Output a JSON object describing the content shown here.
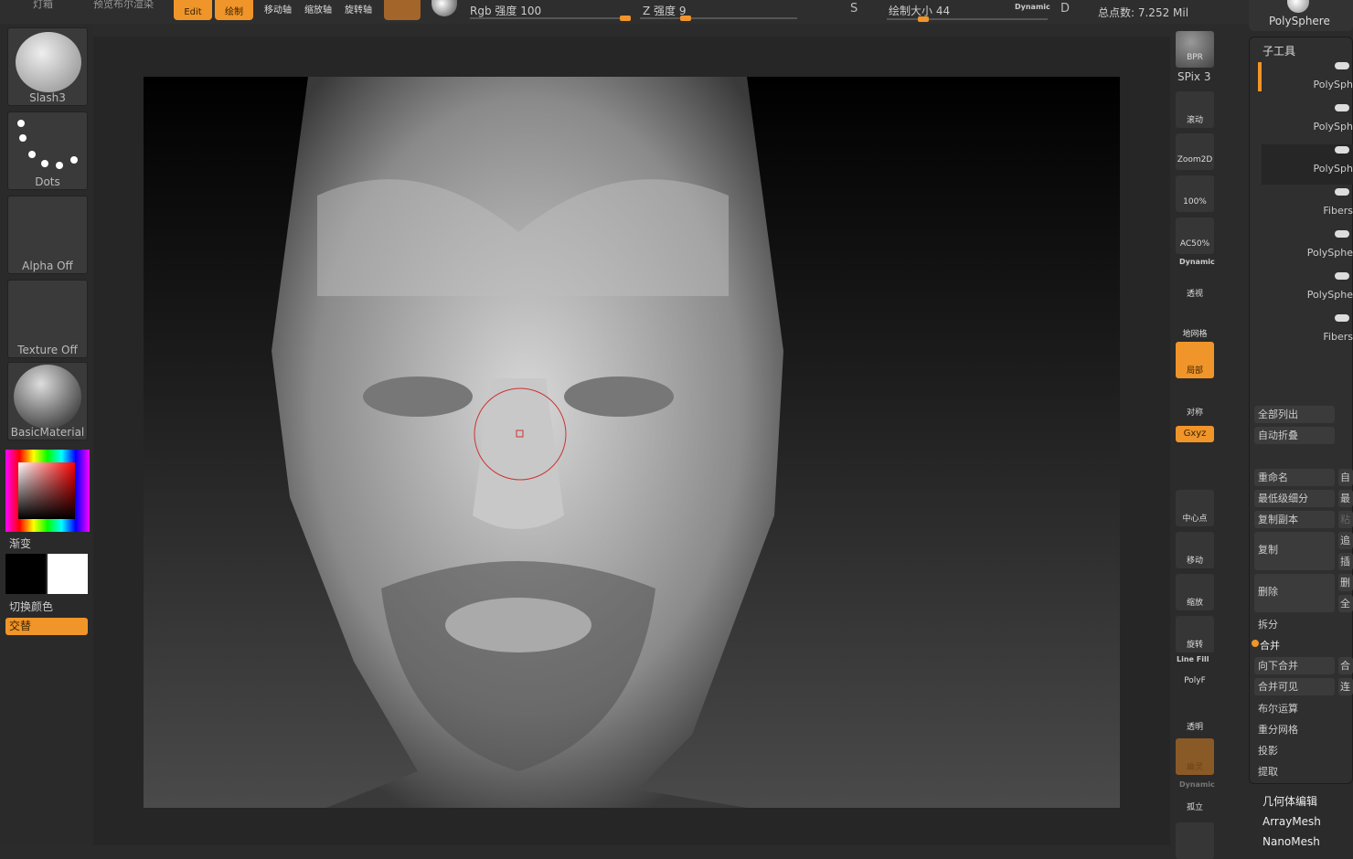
{
  "topbar": {
    "lightbox": "灯箱",
    "preview_bool": "预览布尔渲染",
    "edit": "Edit",
    "draw": "绘制",
    "move_axis": "移动轴",
    "scale_axis": "缩放轴",
    "rotate_axis": "旋转轴",
    "rgb_label": "Rgb 强度 100",
    "rgb_value": 100,
    "z_label": "Z 强度 9",
    "z_value": 9,
    "draw_size_label": "绘制大小 44",
    "draw_size_value": 44,
    "dynamic": "Dynamic",
    "s_icon": "S",
    "d_icon": "D",
    "total_points": "总点数: 7.252 Mil",
    "tool_name": "PolySphere"
  },
  "left": {
    "brush": "Slash3",
    "stroke": "Dots",
    "alpha": "Alpha Off",
    "texture": "Texture Off",
    "material": "BasicMaterial",
    "gradient": "渐变",
    "switch_color": "切换颜色",
    "alternate": "交替"
  },
  "right_toolbar": {
    "bpr": "BPR",
    "spix": "SPix 3",
    "scroll": "滚动",
    "zoom2d": "Zoom2D",
    "pct100": "100%",
    "ac50": "AC50%",
    "dynamic": "Dynamic",
    "persp": "透视",
    "floor": "地网格",
    "local": "局部",
    "sym": "对称",
    "xyz": "Gxyz",
    "center": "中心点",
    "move": "移动",
    "scale": "缩放",
    "rotate": "旋转",
    "linefill": "Line Fill",
    "polyf": "PolyF",
    "transp": "透明",
    "ghost": "幽灵",
    "dynamic2": "Dynamic",
    "solo": "孤立"
  },
  "subtool": {
    "title": "子工具",
    "items": [
      "PolySph",
      "PolySph",
      "PolySph",
      "Fibers",
      "PolySphe",
      "PolySphe",
      "Fibers"
    ],
    "list_all": "全部列出",
    "auto_collapse": "自动折叠",
    "rename": "重命名",
    "rename2": "自",
    "lowest": "最低级细分",
    "lowest2": "最",
    "dup_copy": "复制副本",
    "dup2": "粘",
    "copy": "复制",
    "copy_a": "追",
    "copy_b": "插",
    "delete": "删除",
    "del_a": "删",
    "del_b": "全",
    "split": "拆分",
    "merge": "合并",
    "merge_down": "向下合并",
    "merge_down2": "合",
    "merge_visible": "合并可见",
    "merge_visible2": "连",
    "boolean": "布尔运算",
    "remesh": "重分网格",
    "project": "投影",
    "extract": "提取"
  },
  "sections": [
    "几何体编辑",
    "ArrayMesh",
    "NanoMesh"
  ],
  "colors": {
    "accent": "#f0952a"
  }
}
